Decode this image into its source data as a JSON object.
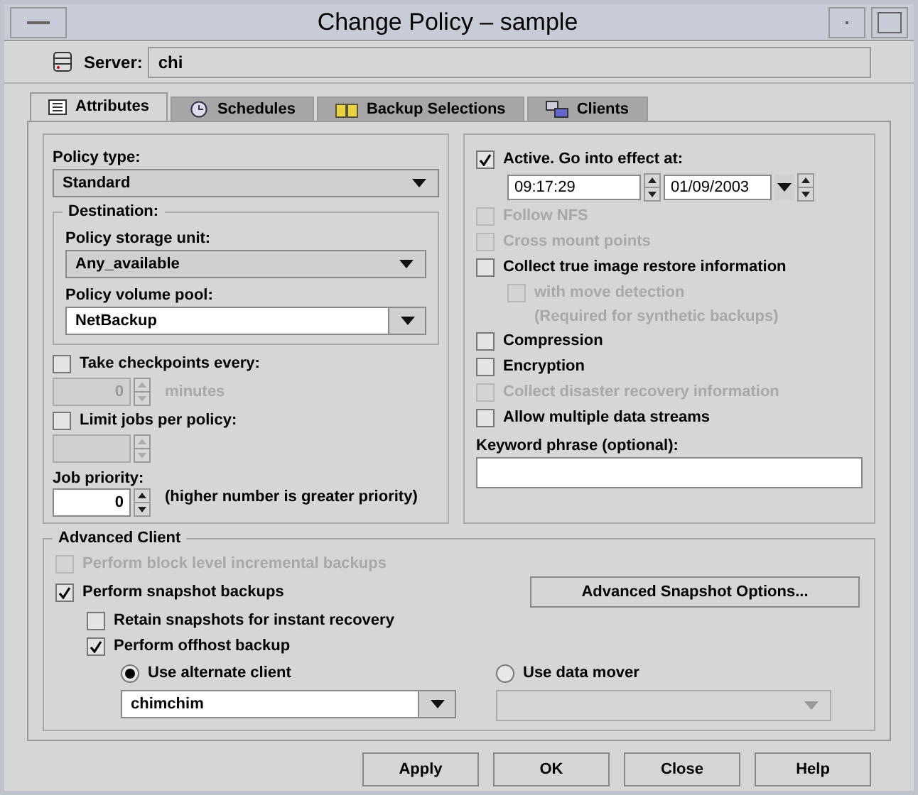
{
  "window": {
    "title": "Change Policy – sample"
  },
  "server": {
    "label": "Server:",
    "value": "chi"
  },
  "tabs": [
    {
      "label": "Attributes",
      "selected": true,
      "kind": "attributes"
    },
    {
      "label": "Schedules",
      "selected": false,
      "kind": "schedules"
    },
    {
      "label": "Backup Selections",
      "selected": false,
      "kind": "selections"
    },
    {
      "label": "Clients",
      "selected": false,
      "kind": "clients"
    }
  ],
  "policy_type": {
    "label": "Policy type:",
    "value": "Standard"
  },
  "destination": {
    "title": "Destination:",
    "storage_unit": {
      "label": "Policy storage unit:",
      "value": "Any_available"
    },
    "volume_pool": {
      "label": "Policy volume pool:",
      "value": "NetBackup"
    }
  },
  "checkpoints": {
    "label": "Take checkpoints every:",
    "checked": false,
    "value": "0",
    "unit": "minutes",
    "disabled": true
  },
  "limit_jobs": {
    "label": "Limit jobs per policy:",
    "checked": false,
    "disabled": true
  },
  "job_priority": {
    "label": "Job priority:",
    "value": "0",
    "note": "(higher number is greater priority)"
  },
  "active": {
    "label": "Active. Go into effect at:",
    "checked": true,
    "time": "09:17:29",
    "date": "01/09/2003"
  },
  "options": [
    {
      "label": "Follow NFS",
      "checked": false,
      "disabled": true
    },
    {
      "label": "Cross mount points",
      "checked": false,
      "disabled": true
    },
    {
      "label": "Collect true image restore information",
      "checked": false,
      "disabled": false,
      "children": [
        {
          "label": "with move detection",
          "checked": false,
          "disabled": true,
          "note": "(Required for synthetic backups)"
        }
      ]
    },
    {
      "label": "Compression",
      "checked": false,
      "disabled": false
    },
    {
      "label": "Encryption",
      "checked": false,
      "disabled": false
    },
    {
      "label": "Collect disaster recovery information",
      "checked": false,
      "disabled": true
    },
    {
      "label": "Allow multiple data streams",
      "checked": false,
      "disabled": false
    }
  ],
  "keyword": {
    "label": "Keyword phrase (optional):"
  },
  "advanced_client": {
    "title": "Advanced Client",
    "block_level": {
      "label": "Perform block level incremental backups",
      "checked": false,
      "disabled": true
    },
    "snapshot": {
      "label": "Perform snapshot backups",
      "checked": true,
      "disabled": false
    },
    "options_button": {
      "label": "Advanced Snapshot Options..."
    },
    "retain": {
      "label": "Retain snapshots for instant recovery",
      "checked": false,
      "disabled": false
    },
    "offhost": {
      "label": "Perform offhost backup",
      "checked": true,
      "disabled": false
    },
    "radios": [
      {
        "label": "Use alternate client",
        "selected": true,
        "value": "chimchim"
      },
      {
        "label": "Use data mover",
        "selected": false
      }
    ]
  },
  "buttons": [
    {
      "label": "Apply"
    },
    {
      "label": "OK"
    },
    {
      "label": "Close"
    },
    {
      "label": "Help"
    }
  ]
}
